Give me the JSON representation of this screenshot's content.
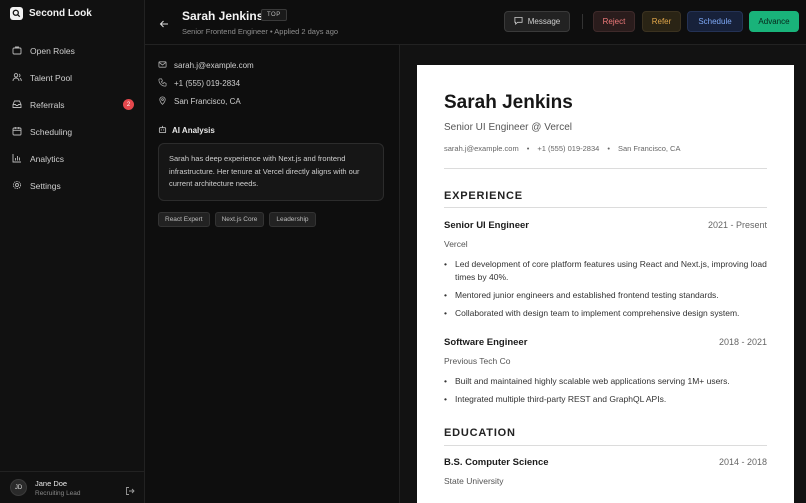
{
  "brand": {
    "name": "Second Look"
  },
  "sidebar": {
    "items": [
      {
        "label": "Open Roles",
        "icon": "briefcase-icon"
      },
      {
        "label": "Talent Pool",
        "icon": "users-icon"
      },
      {
        "label": "Referrals",
        "icon": "inbox-icon",
        "badge": "2"
      },
      {
        "label": "Scheduling",
        "icon": "calendar-icon"
      },
      {
        "label": "Analytics",
        "icon": "chart-icon"
      },
      {
        "label": "Settings",
        "icon": "gear-icon"
      }
    ]
  },
  "user": {
    "initials": "JD",
    "name": "Jane Doe",
    "role": "Recruiting Lead"
  },
  "header": {
    "name": "Sarah Jenkins",
    "tag": "TOP",
    "subtitle": "Senior Frontend Engineer  •  Applied 2 days ago",
    "buttons": {
      "message": "Message",
      "reject": "Reject",
      "refer": "Refer",
      "schedule": "Schedule",
      "advance": "Advance"
    }
  },
  "detail": {
    "email": "sarah.j@example.com",
    "phone": "+1 (555) 019-2834",
    "location": "San Francisco, CA",
    "ai_title": "AI Analysis",
    "ai_text": "Sarah has deep experience with Next.js and frontend infrastructure. Her tenure at Vercel directly aligns with our current architecture needs.",
    "tags": [
      "React Expert",
      "Next.js Core",
      "Leadership"
    ]
  },
  "resume": {
    "name": "Sarah Jenkins",
    "title": "Senior UI Engineer @ Vercel",
    "email": "sarah.j@example.com",
    "phone": "+1 (555) 019-2834",
    "location": "San Francisco, CA",
    "experience_heading": "EXPERIENCE",
    "jobs": [
      {
        "role": "Senior UI Engineer",
        "dates": "2021 - Present",
        "company": "Vercel",
        "bullets": [
          "Led development of core platform features using React and Next.js, improving load times by 40%.",
          "Mentored junior engineers and established frontend testing standards.",
          "Collaborated with design team to implement comprehensive design system."
        ]
      },
      {
        "role": "Software Engineer",
        "dates": "2018 - 2021",
        "company": "Previous Tech Co",
        "bullets": [
          "Built and maintained highly scalable web applications serving 1M+ users.",
          "Integrated multiple third-party REST and GraphQL APIs."
        ]
      }
    ],
    "education_heading": "EDUCATION",
    "education": {
      "degree": "B.S. Computer Science",
      "dates": "2014 - 2018",
      "school": "State University"
    }
  }
}
